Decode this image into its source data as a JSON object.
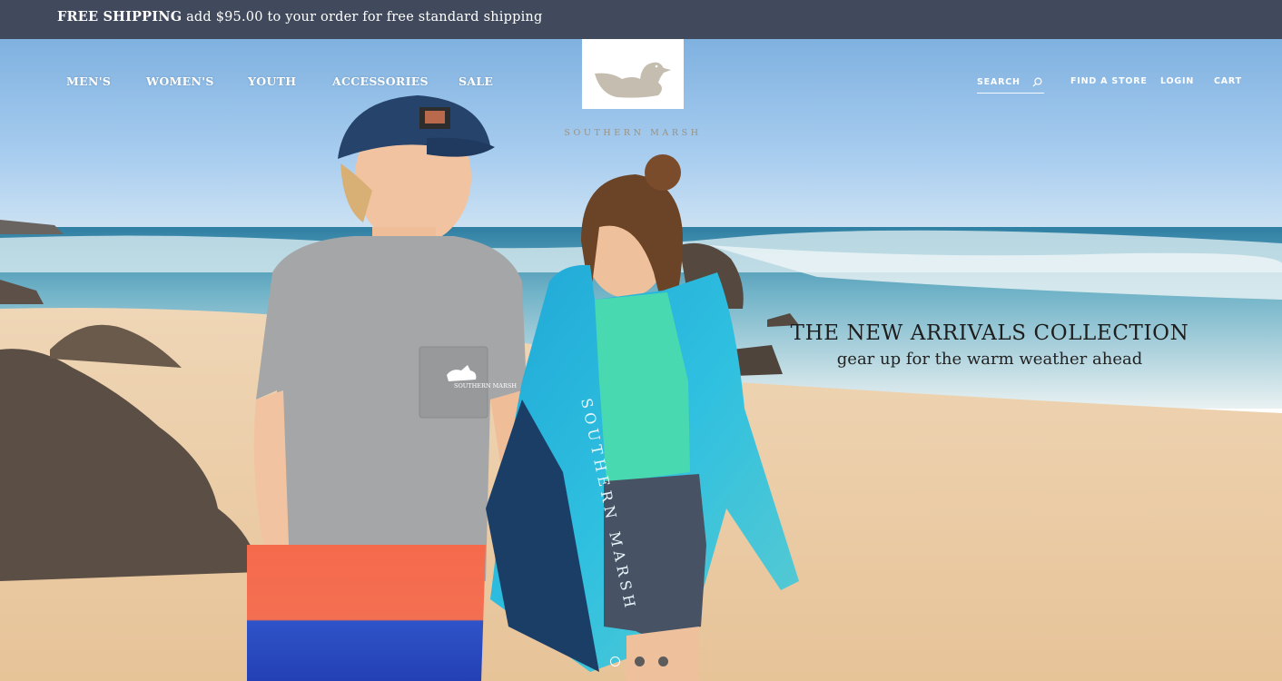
{
  "promo": {
    "bold": "FREE SHIPPING",
    "text": " add $95.00 to your order for free standard shipping"
  },
  "nav": {
    "left": [
      "MEN'S",
      "WOMEN'S",
      "YOUTH",
      "ACCESSORIES",
      "SALE"
    ],
    "search_label": "SEARCH",
    "right": [
      "FIND A STORE",
      "LOGIN",
      "CART"
    ]
  },
  "brand": {
    "name": "SOUTHERN MARSH"
  },
  "hero": {
    "headline": "THE NEW ARRIVALS COLLECTION",
    "subline": "gear up for the warm weather ahead",
    "pocket_logo": "SOUTHERN MARSH",
    "towel_text": "SOUTHERN MARSH",
    "slides": 3,
    "active_slide": 1
  },
  "colors": {
    "promo_bg": "#414a5c",
    "sky": "#8fbde6",
    "ocean": "#3b8fb0",
    "sand": "#eac9a3",
    "logo_duck": "#c4bdb0"
  }
}
